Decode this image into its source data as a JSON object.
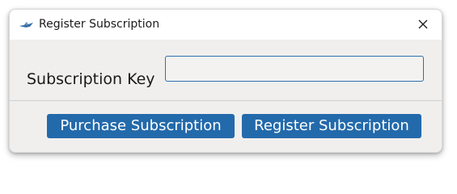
{
  "window": {
    "title": "Register Subscription",
    "close_icon": "close-icon",
    "app_icon": "bird-app-icon"
  },
  "form": {
    "key_label": "Subscription Key",
    "key_value": "",
    "key_placeholder": ""
  },
  "buttons": {
    "purchase_label": "Purchase Subscription",
    "register_label": "Register Subscription"
  },
  "colors": {
    "button_bg": "#236aab",
    "button_text": "#ffffff",
    "input_border": "#2f6fad",
    "dialog_bg": "#f0efee",
    "titlebar_bg": "#ffffff"
  }
}
